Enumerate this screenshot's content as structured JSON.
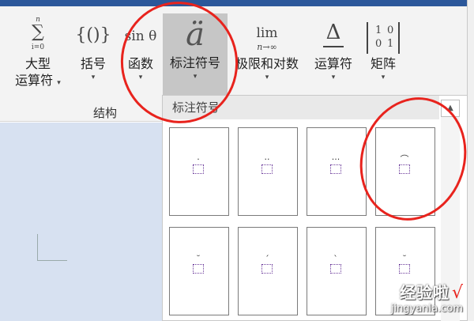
{
  "ribbon": {
    "buttons": [
      {
        "label1": "大型",
        "label2": "运算符",
        "has_dropdown": true
      },
      {
        "label1": "括号",
        "has_dropdown": true
      },
      {
        "label1": "函数",
        "has_dropdown": true
      },
      {
        "label1": "标注符号",
        "has_dropdown": true,
        "selected": true
      },
      {
        "label1": "极限和对数",
        "has_dropdown": true
      },
      {
        "label1": "运算符",
        "has_dropdown": true
      },
      {
        "label1": "矩阵",
        "has_dropdown": true
      }
    ],
    "glyphs": {
      "sum_top": "n",
      "sum_symbol": "∑",
      "sum_bottom": "i=0",
      "brackets": "{()}",
      "function": "sin θ",
      "accent": "ä",
      "limit_top": "lim",
      "limit_bottom": "n→∞",
      "operator": "Δ",
      "matrix": [
        "1",
        "0",
        "0",
        "1"
      ]
    },
    "dropdown_caret": "▾",
    "group_label": "结构"
  },
  "gallery": {
    "header": "标注符号",
    "scroll_up": "▲",
    "tiles": [
      {
        "mark": "·",
        "desc": "dot"
      },
      {
        "mark": "··",
        "desc": "double-dot"
      },
      {
        "mark": "···",
        "desc": "triple-dot"
      },
      {
        "mark": "⌒",
        "desc": "hat-arc"
      },
      {
        "mark": "˘",
        "desc": "breve"
      },
      {
        "mark": "ˊ",
        "desc": "acute"
      },
      {
        "mark": "ˋ",
        "desc": "grave"
      },
      {
        "mark": "˘",
        "desc": "breve-2"
      }
    ]
  },
  "watermark": {
    "cn": "经验啦",
    "check": "√",
    "url": "jingyanla.com"
  },
  "colors": {
    "title_bar": "#2b579a",
    "selected_button": "#c6c6c6",
    "annotation_circle": "#e8231d",
    "document_bg": "#d7e1f1"
  }
}
